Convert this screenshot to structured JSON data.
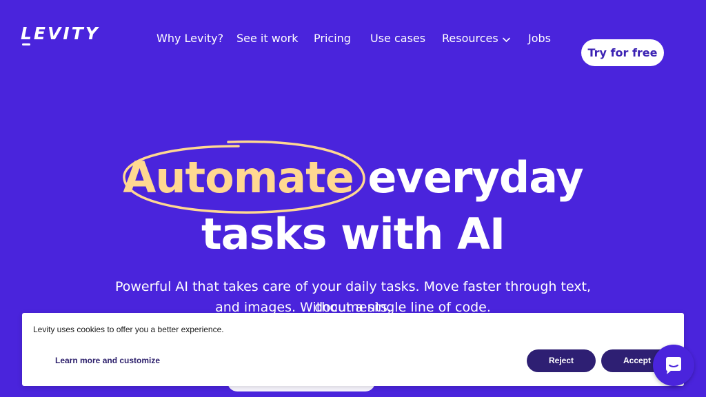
{
  "brand": {
    "logo_text": "LEVITY"
  },
  "nav": {
    "items": [
      {
        "label": "Why Levity?"
      },
      {
        "label": "See it work"
      },
      {
        "label": "Pricing"
      },
      {
        "label": "Use cases"
      },
      {
        "label": "Resources"
      },
      {
        "label": "Jobs"
      }
    ],
    "cta_label": "Try for free"
  },
  "hero": {
    "highlight": "Automate",
    "line1_rest": "everyday",
    "line2": "tasks with AI",
    "sub_line1": "Powerful AI that takes care of your daily tasks. Move faster through text, documents,",
    "sub_line2": "and images. Without a single line of code."
  },
  "cookie_banner": {
    "message": "Levity uses cookies to offer you a better experience.",
    "learn_more": "Learn more and customize",
    "reject_label": "Reject",
    "accept_label": "Accept"
  },
  "icons": {
    "resources_dropdown": "chevron-down-icon",
    "chat": "chat-bubble-icon"
  },
  "colors": {
    "background": "#4a24dc",
    "accent": "#ffd891",
    "cta_text": "#3b22b3",
    "cookie_button": "#2e1f73"
  }
}
